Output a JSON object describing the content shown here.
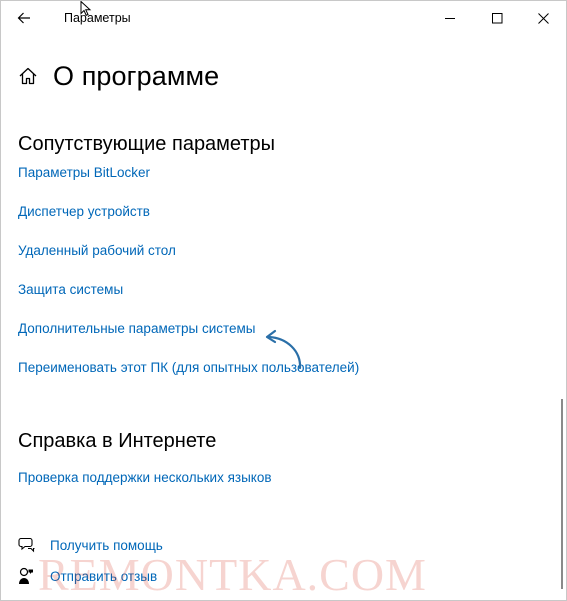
{
  "window": {
    "title": "Параметры"
  },
  "page": {
    "title": "О программе"
  },
  "related": {
    "title": "Сопутствующие параметры",
    "links": [
      "Параметры BitLocker",
      "Диспетчер устройств",
      "Удаленный рабочий стол",
      "Защита системы",
      "Дополнительные параметры системы",
      "Переименовать этот ПК (для опытных пользователей)"
    ]
  },
  "web_help": {
    "title": "Справка в Интернете",
    "links": [
      "Проверка поддержки нескольких языков"
    ]
  },
  "footer": {
    "get_help": "Получить помощь",
    "feedback": "Отправить отзыв"
  },
  "watermark": "REMONTKA.COM",
  "colors": {
    "link": "#0067b8",
    "watermark": "#d73c28"
  }
}
